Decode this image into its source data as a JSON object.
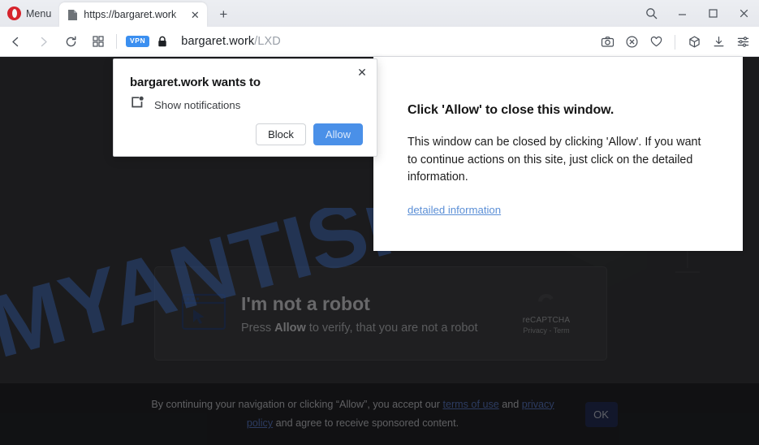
{
  "browser": {
    "menu_label": "Menu",
    "tab": {
      "title": "https://bargaret.work",
      "close_glyph": "✕",
      "favicon_name": "page-favicon"
    },
    "newtab_glyph": "+",
    "window_controls": {
      "search_glyph": "⌕",
      "minimize_glyph": "–",
      "maximize_glyph": "□",
      "close_glyph": "✕"
    },
    "nav": {
      "back_glyph": "‹",
      "forward_glyph": "›",
      "reload_glyph": "⟳",
      "tabs_glyph": "⌸",
      "vpn_badge": "VPN",
      "url_host": "bargaret.work",
      "url_path": "/LXD"
    },
    "toolbar_right": [
      {
        "name": "snapshot-icon"
      },
      {
        "name": "ad-blocker-icon"
      },
      {
        "name": "heart-icon"
      },
      {
        "name": "extensions-cube-icon"
      },
      {
        "name": "downloads-icon"
      },
      {
        "name": "easy-setup-icon"
      }
    ]
  },
  "permission_dialog": {
    "title": "bargaret.work wants to",
    "permission_label": "Show notifications",
    "close_glyph": "✕",
    "block_label": "Block",
    "allow_label": "Allow",
    "allow_color": "#4a90e8"
  },
  "fake_overlay": {
    "title": "Click 'Allow' to close this window.",
    "body": "This window can be closed by clicking 'Allow'. If you want to continue actions on this site, just click on the detailed information.",
    "link_label": "detailed information",
    "link_color": "#5b8fd6"
  },
  "page": {
    "captcha": {
      "icon_name": "browser-window-cursor-icon",
      "title": "I'm not a robot",
      "sub_prefix": "Press ",
      "sub_bold": "Allow",
      "sub_suffix": " to verify, that you are not a robot",
      "recaptcha_name": "reCAPTCHA",
      "recaptcha_terms": "Privacy - Term"
    },
    "cookie_bar": {
      "text_1": "By continuing your navigation or clicking “Allow”, you accept our ",
      "link_1": "terms of use",
      "text_2": " and ",
      "link_2": "privacy policy",
      "text_3": " and agree to receive sponsored content.",
      "ok_label": "OK"
    },
    "background_color": "#333435"
  },
  "watermark": {
    "text": "MYANTISPYWARE.COM",
    "color": "#2b4a80"
  }
}
